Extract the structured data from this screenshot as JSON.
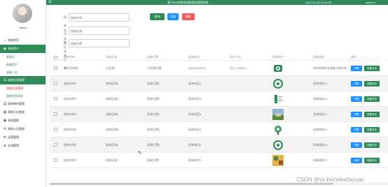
{
  "sidebar": {
    "username": "admin",
    "items": [
      {
        "icon": "home-icon",
        "glyph": "⌂",
        "label": "系统首页",
        "type": "normal"
      },
      {
        "icon": "user-icon",
        "glyph": "◉",
        "label": "系统用户",
        "type": "active-group"
      },
      {
        "label": "管理员",
        "type": "sub"
      },
      {
        "label": "普通用户",
        "type": "sub"
      },
      {
        "label": "园林人员",
        "type": "sub"
      },
      {
        "icon": "list-icon",
        "glyph": "☰",
        "label": "园林信息管理",
        "type": "active-group"
      },
      {
        "label": "园林信息管理",
        "type": "sub current"
      },
      {
        "label": "园林信息添加",
        "type": "sub"
      },
      {
        "icon": "doc-icon",
        "glyph": "▤",
        "label": "园林预约管理",
        "type": "normal"
      },
      {
        "icon": "calendar-icon",
        "glyph": "▦",
        "label": "园林日志管理",
        "type": "normal"
      },
      {
        "icon": "grid-icon",
        "glyph": "▣",
        "label": "系统管理",
        "type": "normal"
      },
      {
        "icon": "chat-icon",
        "glyph": "✉",
        "label": "通知公告管理",
        "type": "normal"
      },
      {
        "icon": "gear-icon",
        "glyph": "⚙",
        "label": "运营管理",
        "type": "normal"
      },
      {
        "icon": "map-icon",
        "glyph": "◈",
        "label": "交流管理",
        "type": "normal"
      }
    ]
  },
  "topbar": {
    "title": "基于B/S的城市园林绿化管理系统",
    "time": "2024-02-28 16:39:52",
    "user": "admin ▾"
  },
  "search": {
    "fields": [
      {
        "label": "园林名称",
        "placeholder": "园林名称"
      },
      {
        "label": "园林区域",
        "placeholder": "园林区域"
      },
      {
        "label": "园林位置",
        "placeholder": "园林位置"
      }
    ],
    "buttons": [
      {
        "label": "查询",
        "color": "#2e8b57"
      },
      {
        "label": "添加",
        "color": "#1e90ff"
      },
      {
        "label": "删除",
        "color": "#f05a5a"
      }
    ]
  },
  "table": {
    "columns": [
      "园林名称",
      "园林区域",
      "园林位置",
      "园林电话",
      "养护人员",
      "园林图片",
      "园林描述",
      "操作"
    ],
    "rows": [
      {
        "name": "22区苏林林",
        "area": "22区域",
        "location": "22园林位置",
        "phone": "18191636723",
        "person": "员工1-999977",
        "desc": "如何的园林全景能力描述有",
        "thumb": "green-badge"
      },
      {
        "name": "园林名称2",
        "area": "园林区域2",
        "location": "园林位置2",
        "phone": "园林电话2",
        "person": "",
        "desc": "园林描述12",
        "thumb": "green-ring"
      },
      {
        "name": "园林名称3",
        "area": "园林区域3",
        "location": "园林位置3",
        "phone": "园林电话3",
        "person": "",
        "desc": "园林描述13",
        "thumb": "green-board"
      },
      {
        "name": "园林名称4",
        "area": "园林区域4",
        "location": "园林位置4",
        "phone": "园林电话4",
        "person": "",
        "desc": "园林描述14",
        "thumb": "landscape"
      },
      {
        "name": "园林名称5",
        "area": "园林区域5",
        "location": "园林位置5",
        "phone": "园林电话5",
        "person": "",
        "desc": "园林描述15",
        "thumb": "green-leaf"
      },
      {
        "name": "园林名称6",
        "area": "园林区域6",
        "location": "园林位置6",
        "phone": "园林电话6",
        "person": "",
        "desc": "园林描述16",
        "thumb": "green-ring"
      },
      {
        "name": "园林名称7",
        "area": "园林区域7",
        "location": "园林位置7",
        "phone": "园林电话7",
        "person": "",
        "desc": "园林描述17",
        "thumb": "colorful"
      }
    ],
    "detail_label": "详情",
    "eval_label": "查看评论"
  },
  "watermark": "CSDN @vx-bishekaifayuan"
}
